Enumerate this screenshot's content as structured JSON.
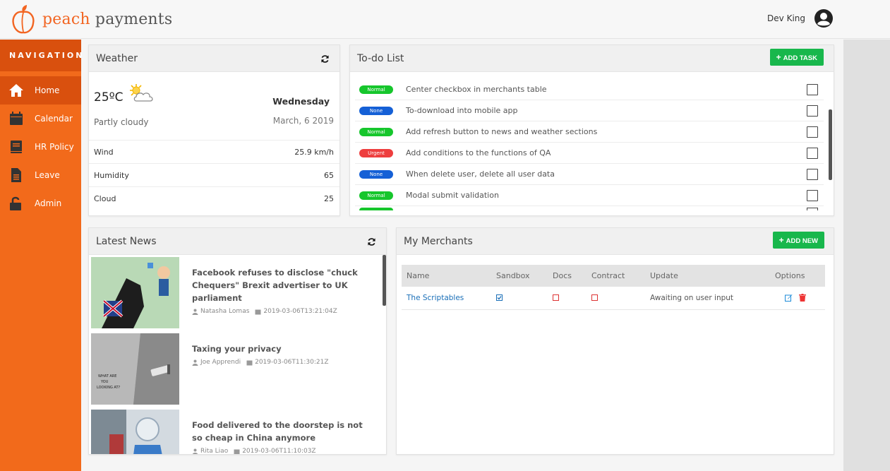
{
  "app": {
    "logo_word1": "peach",
    "logo_word2": "payments",
    "user_name": "Dev King"
  },
  "sidebar": {
    "title": "NAVIGATION",
    "items": [
      {
        "label": "Home",
        "icon": "home-icon",
        "active": true
      },
      {
        "label": "Calendar",
        "icon": "calendar-icon"
      },
      {
        "label": "HR Policy",
        "icon": "book-icon"
      },
      {
        "label": "Leave",
        "icon": "document-icon"
      },
      {
        "label": "Admin",
        "icon": "unlock-icon"
      }
    ]
  },
  "weather": {
    "title": "Weather",
    "temperature": "25ºC",
    "description": "Partly cloudy",
    "day": "Wednesday",
    "date": "March, 6 2019",
    "rows": [
      {
        "label": "Wind",
        "value": "25.9 km/h"
      },
      {
        "label": "Humidity",
        "value": "65"
      },
      {
        "label": "Cloud",
        "value": "25"
      }
    ]
  },
  "todo": {
    "title": "To-do List",
    "add_label": "ADD TASK",
    "items": [
      {
        "badge": "Normal",
        "text": "Center checkbox in merchants table"
      },
      {
        "badge": "None",
        "text": "To-download into mobile app"
      },
      {
        "badge": "Normal",
        "text": "Add refresh button to news and weather sections"
      },
      {
        "badge": "Urgent",
        "text": "Add conditions to the functions of QA"
      },
      {
        "badge": "None",
        "text": "When delete user, delete all user data"
      },
      {
        "badge": "Normal",
        "text": "Modal submit validation"
      }
    ]
  },
  "news": {
    "title": "Latest News",
    "items": [
      {
        "title": "Facebook refuses to disclose \"chuck Chequers\" Brexit advertiser to UK parliament",
        "author": "Natasha Lomas",
        "date": "2019-03-06T13:21:04Z"
      },
      {
        "title": "Taxing your privacy",
        "author": "Joe Apprendi",
        "date": "2019-03-06T11:30:21Z"
      },
      {
        "title": "Food delivered to the doorstep is not so cheap in China anymore",
        "author": "Rita Liao",
        "date": "2019-03-06T11:10:03Z"
      }
    ]
  },
  "merchants": {
    "title": "My Merchants",
    "add_label": "ADD NEW",
    "columns": [
      "Name",
      "Sandbox",
      "Docs",
      "Contract",
      "Update",
      "Options"
    ],
    "rows": [
      {
        "name": "The Scriptables",
        "update": "Awaiting on user input"
      }
    ]
  },
  "colors": {
    "brand": "#f26a1b",
    "brand_dark": "#d9500e",
    "green": "#18b74c",
    "badge_normal": "#16c62c",
    "badge_none": "#1560d6",
    "badge_urgent": "#ee3e3e"
  }
}
